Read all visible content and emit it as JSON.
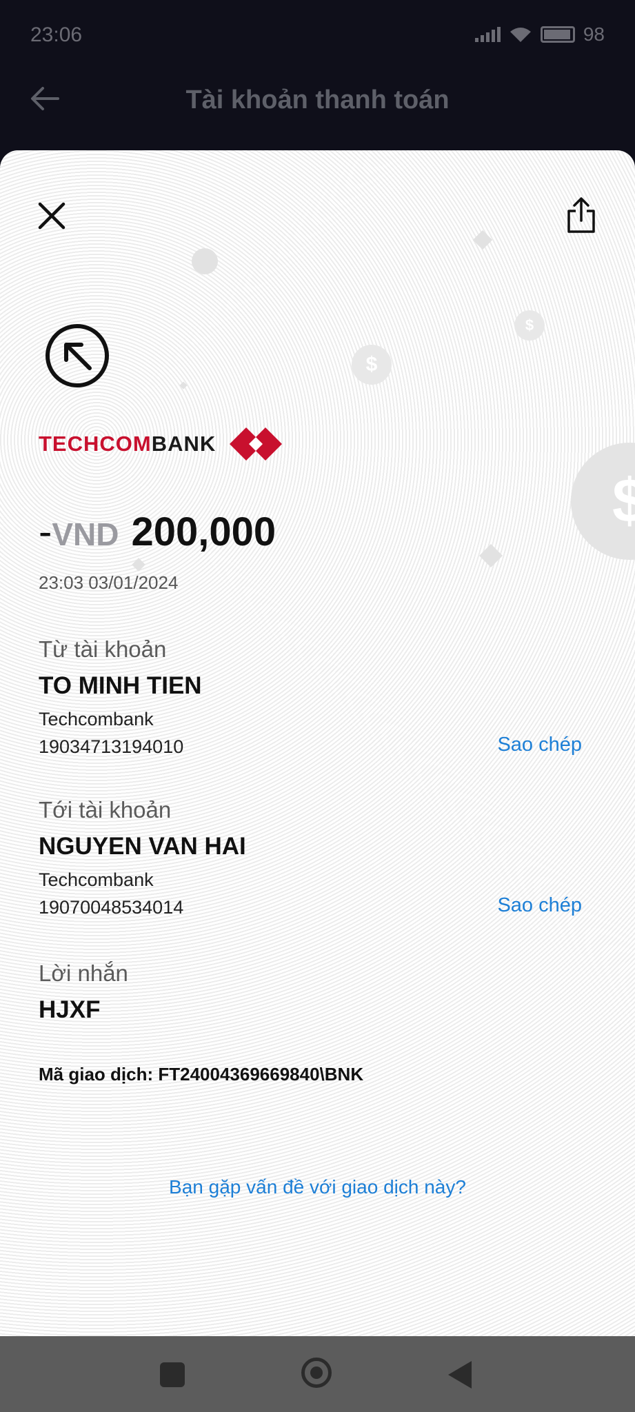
{
  "status_bar": {
    "time": "23:06",
    "battery": "98"
  },
  "header": {
    "title": "Tài khoản thanh toán"
  },
  "brand": {
    "name_red": "TECHCOM",
    "name_dark": "BANK",
    "red": "#c8102e"
  },
  "transaction": {
    "sign": "-",
    "currency": "VND",
    "amount": "200,000",
    "datetime": "23:03 03/01/2024"
  },
  "from": {
    "label": "Từ tài khoản",
    "name": "TO MINH TIEN",
    "bank": "Techcombank",
    "account": "19034713194010",
    "copy_label": "Sao chép"
  },
  "to": {
    "label": "Tới tài khoản",
    "name": "NGUYEN VAN HAI",
    "bank": "Techcombank",
    "account": "19070048534014",
    "copy_label": "Sao chép"
  },
  "message": {
    "label": "Lời nhắn",
    "value": "HJXF"
  },
  "tx_id": "Mã giao dịch: FT24004369669840\\BNK",
  "problem_link": "Bạn gặp vấn đề với giao dịch này?",
  "link_color": "#1d7fd6",
  "icons": [
    "back-arrow-icon",
    "close-icon",
    "share-icon",
    "outgoing-arrow-icon",
    "techcombank-logo",
    "wifi-icon",
    "battery-icon"
  ]
}
